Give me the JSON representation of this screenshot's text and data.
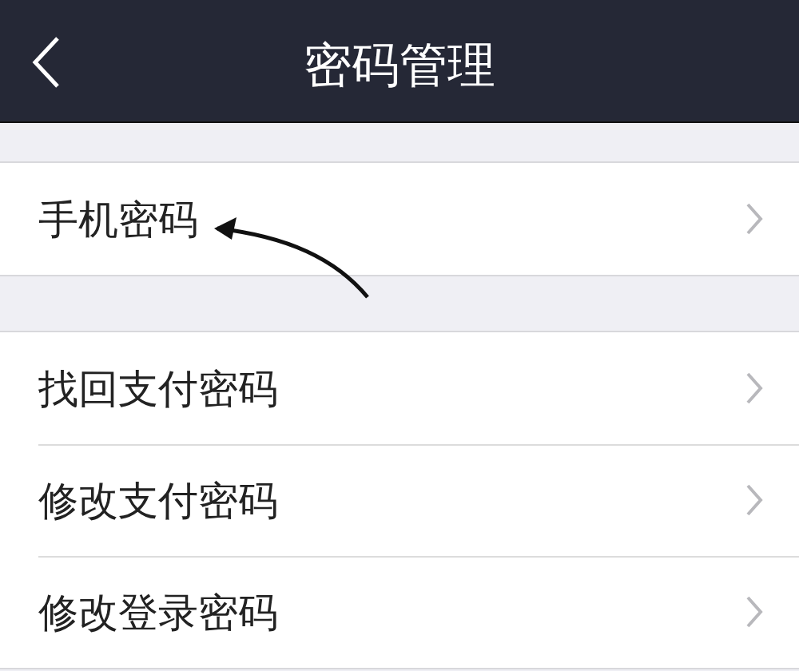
{
  "nav_bar": {
    "title": "密码管理"
  },
  "groups": [
    [
      {
        "label": "手机密码"
      }
    ],
    [
      {
        "label": "找回支付密码"
      },
      {
        "label": "修改支付密码"
      },
      {
        "label": "修改登录密码"
      }
    ]
  ]
}
